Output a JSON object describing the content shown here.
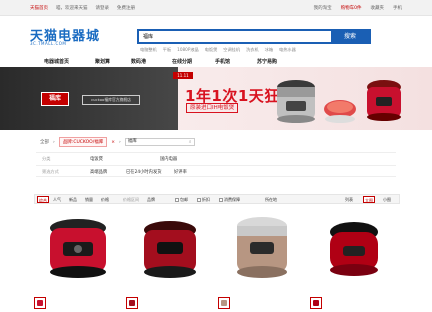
{
  "topbar": {
    "left": [
      "天猫首页",
      "喵，欢迎来天猫",
      "请登录",
      "免费注册"
    ],
    "right": [
      "我的淘宝",
      "购物车0件",
      "收藏夹",
      "手机"
    ]
  },
  "header": {
    "logo": "天猫电器城",
    "logo_sub": "3C.TMALL.COM",
    "search_value": "福库",
    "search_button": "搜索",
    "hotwords": [
      "电脑整机",
      "平板",
      "1080P液晶",
      "电饭煲",
      "空调挂机",
      "洗衣机",
      "冰箱",
      "电热水器"
    ]
  },
  "nav": [
    "电器城首页",
    "聚划算",
    "数码港",
    "在线分期",
    "手机馆",
    "苏宁易购"
  ],
  "banner": {
    "brand_logo": "福库",
    "brand_tag": "cuckoo福库官方旗舰店",
    "badge": "11.11",
    "slogan": "1年1次1天狂欢",
    "sub": "原装进口IH电饭煲"
  },
  "breadcrumb": {
    "all": "全部",
    "tag": "品牌:CUCKOO/福库",
    "query": "福库"
  },
  "filters": [
    {
      "label": "分类",
      "options": [
        "电饭煲",
        "国内电器"
      ]
    },
    {
      "label": "筛选方式",
      "options": [
        "高端品牌",
        "已在24小时内发货",
        "好评率"
      ]
    }
  ],
  "sort": {
    "items": [
      "综合",
      "人气",
      "新品",
      "销量",
      "价格"
    ],
    "price_from": "价格区间",
    "brand": "品牌",
    "options": [
      "包邮",
      "折扣",
      "消费保障"
    ],
    "location": "所在地",
    "view": [
      "列表",
      "大图",
      "小图"
    ]
  },
  "products": [
    {
      "name": "product-1",
      "color": "#c8102e"
    },
    {
      "name": "product-2",
      "color": "#a30e1e"
    },
    {
      "name": "product-3",
      "color": "#b79682"
    },
    {
      "name": "product-4",
      "color": "#b00014"
    }
  ]
}
